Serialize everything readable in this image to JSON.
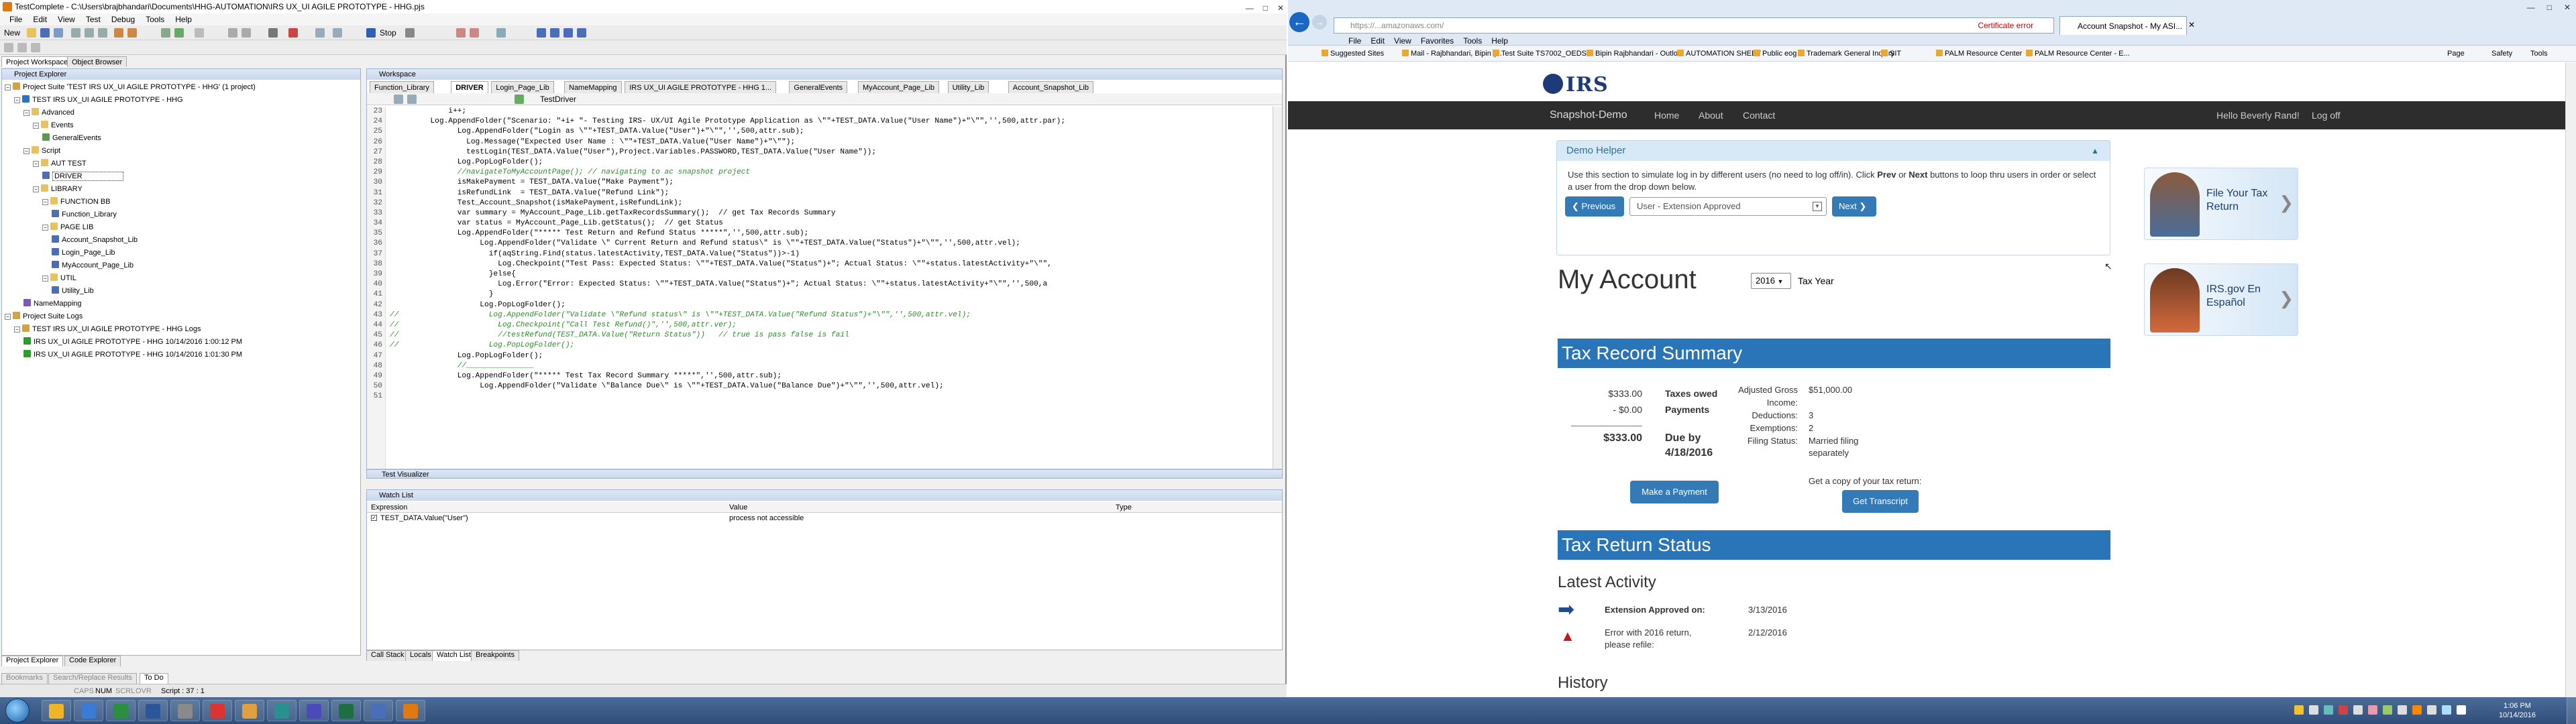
{
  "ide": {
    "title": "TestComplete - C:\\Users\\brajbhandari\\Documents\\HHG-AUTOMATION\\IRS UX_UI AGILE PROTOTYPE - HHG.pjs",
    "menu": [
      "File",
      "Edit",
      "View",
      "Test",
      "Debug",
      "Tools",
      "Help"
    ],
    "new_label": "New",
    "stop_label": "Stop",
    "panel_tabs": [
      "Project Workspace",
      "Object Browser"
    ],
    "project_explorer": {
      "title": "Project Explorer",
      "tree": [
        {
          "level": 0,
          "label": "Project Suite 'TEST IRS UX_UI AGILE PROTOTYPE - HHG' (1 project)",
          "color": "#d6a23a",
          "expand": "−"
        },
        {
          "level": 1,
          "label": "TEST IRS UX_UI AGILE PROTOTYPE - HHG",
          "color": "#2f72c4",
          "expand": "−"
        },
        {
          "level": 2,
          "label": "Advanced",
          "color": "#e8c25a",
          "expand": "−"
        },
        {
          "level": 3,
          "label": "Events",
          "color": "#e8c25a",
          "expand": "−"
        },
        {
          "level": 4,
          "label": "GeneralEvents",
          "color": "#5a9b4c",
          "expand": ""
        },
        {
          "level": 2,
          "label": "Script",
          "color": "#e8c25a",
          "expand": "−"
        },
        {
          "level": 3,
          "label": "AUT TEST",
          "color": "#e8c25a",
          "expand": "−"
        },
        {
          "level": 4,
          "label": "DRIVER",
          "color": "#4a6fb8",
          "expand": "",
          "selected": true
        },
        {
          "level": 3,
          "label": "LIBRARY",
          "color": "#e8c25a",
          "expand": "−"
        },
        {
          "level": 4,
          "label": "FUNCTION BB",
          "color": "#e8c25a",
          "expand": "−"
        },
        {
          "level": 5,
          "label": "Function_Library",
          "color": "#4a6fb8",
          "expand": ""
        },
        {
          "level": 4,
          "label": "PAGE LIB",
          "color": "#e8c25a",
          "expand": "−"
        },
        {
          "level": 5,
          "label": "Account_Snapshot_Lib",
          "color": "#4a6fb8",
          "expand": ""
        },
        {
          "level": 5,
          "label": "Login_Page_Lib",
          "color": "#4a6fb8",
          "expand": ""
        },
        {
          "level": 5,
          "label": "MyAccount_Page_Lib",
          "color": "#4a6fb8",
          "expand": ""
        },
        {
          "level": 4,
          "label": "UTIL",
          "color": "#e8c25a",
          "expand": "−"
        },
        {
          "level": 5,
          "label": "Utility_Lib",
          "color": "#4a6fb8",
          "expand": ""
        },
        {
          "level": 2,
          "label": "NameMapping",
          "color": "#7a5ab8",
          "expand": ""
        },
        {
          "level": 0,
          "label": "Project Suite Logs",
          "color": "#d6a23a",
          "expand": "−"
        },
        {
          "level": 1,
          "label": "TEST IRS UX_UI AGILE PROTOTYPE - HHG Logs",
          "color": "#d6a23a",
          "expand": "−"
        },
        {
          "level": 2,
          "label": "IRS UX_UI AGILE PROTOTYPE - HHG 10/14/2016 1:00:12 PM",
          "color": "#2aa02a",
          "expand": ""
        },
        {
          "level": 2,
          "label": "IRS UX_UI AGILE PROTOTYPE - HHG 10/14/2016 1:01:30 PM",
          "color": "#2aa02a",
          "expand": ""
        }
      ],
      "bottom_tabs": [
        "Project Explorer",
        "Code Explorer"
      ],
      "bottom_tabs2": [
        "Bookmarks",
        "Search/Replace Results",
        "To Do"
      ]
    },
    "workspace": {
      "title": "Workspace",
      "tabs": [
        "Function_Library",
        "DRIVER",
        "Login_Page_Lib",
        "NameMapping",
        "IRS UX_UI AGILE PROTOTYPE - HHG 1...",
        "GeneralEvents",
        "MyAccount_Page_Lib",
        "Utility_Lib",
        "Account_Snapshot_Lib"
      ],
      "active_tab": "DRIVER",
      "toolbar_label": "TestDriver",
      "line_numbers": [
        "23",
        "24",
        "25",
        "26",
        "27",
        "28",
        "29",
        "30",
        "31",
        "32",
        "33",
        "34",
        "35",
        "36",
        "37",
        "38",
        "39",
        "40",
        "41",
        "42",
        "43",
        "44",
        "45",
        "46",
        "47",
        "48",
        "49",
        "50",
        "51"
      ],
      "code": [
        {
          "t": "             i++;",
          "c": ""
        },
        {
          "t": "         Log.AppendFolder(\"Scenario: \"+i+ \"- Testing IRS- UX/UI Agile Prototype Application as \\\"\"+TEST_DATA.Value(\"User Name\")+\"\\\"\",'',500,attr.par);",
          "c": ""
        },
        {
          "t": "               Log.AppendFolder(\"Login as \\\"\"+TEST_DATA.Value(\"User\")+\"\\\"\",'',500,attr.sub);",
          "c": ""
        },
        {
          "t": "                 Log.Message(\"Expected User Name : \\\"\"+TEST_DATA.Value(\"User Name\")+\"\\\"\");",
          "c": ""
        },
        {
          "t": "                 testLogin(TEST_DATA.Value(\"User\"),Project.Variables.PASSWORD,TEST_DATA.Value(\"User Name\"));",
          "c": ""
        },
        {
          "t": "               Log.PopLogFolder();",
          "c": ""
        },
        {
          "t": "               //navigateToMyAccountPage(); // navigating to ac snapshot project",
          "c": "cmt"
        },
        {
          "t": "               isMakePayment = TEST_DATA.Value(\"Make Payment\");",
          "c": ""
        },
        {
          "t": "               isRefundLink  = TEST_DATA.Value(\"Refund Link\");",
          "c": ""
        },
        {
          "t": "               Test_Account_Snapshot(isMakePayment,isRefundLink);",
          "c": ""
        },
        {
          "t": "               var summary = MyAccount_Page_Lib.getTaxRecordsSummary();  // get Tax Records Summary",
          "c": ""
        },
        {
          "t": "               var status = MyAccount_Page_Lib.getStatus();  // get Status",
          "c": ""
        },
        {
          "t": "               Log.AppendFolder(\"***** Test Return and Refund Status *****\",'',500,attr.sub);",
          "c": ""
        },
        {
          "t": "                    Log.AppendFolder(\"Validate \\\" Current Return and Refund status\\\" is \\\"\"+TEST_DATA.Value(\"Status\")+\"\\\"\",'',500,attr.vel);",
          "c": ""
        },
        {
          "t": "                      if(aqString.Find(status.latestActivity,TEST_DATA.Value(\"Status\"))>-1)",
          "c": ""
        },
        {
          "t": "                        Log.Checkpoint(\"Test Pass: Expected Status: \\\"\"+TEST_DATA.Value(\"Status\")+\"; Actual Status: \\\"\"+status.latestActivity+\"\\\"\",",
          "c": ""
        },
        {
          "t": "                      }else{",
          "c": ""
        },
        {
          "t": "                        Log.Error(\"Error: Expected Status: \\\"\"+TEST_DATA.Value(\"Status\")+\"; Actual Status: \\\"\"+status.latestActivity+\"\\\"\",'',500,a",
          "c": ""
        },
        {
          "t": "                      }",
          "c": ""
        },
        {
          "t": "                    Log.PopLogFolder();",
          "c": ""
        },
        {
          "t": "//                    Log.AppendFolder(\"Validate \\\"Refund status\\\" is \\\"\"+TEST_DATA.Value(\"Refund Status\")+\"\\\"\",'',500,attr.vel);",
          "c": "cmt"
        },
        {
          "t": "//                      Log.Checkpoint(\"Call Test Refund()\",'',500,attr.ver);",
          "c": "cmt"
        },
        {
          "t": "//                      //testRefund(TEST_DATA.Value(\"Return Status\"))   // true is pass false is fail",
          "c": "cmt"
        },
        {
          "t": "//                    Log.PopLogFolder();",
          "c": "cmt"
        },
        {
          "t": "               Log.PopLogFolder();",
          "c": ""
        },
        {
          "t": "               //_______________",
          "c": "cmt"
        },
        {
          "t": "               Log.AppendFolder(\"***** Test Tax Record Summary *****\",'',500,attr.sub);",
          "c": ""
        },
        {
          "t": "                    Log.AppendFolder(\"Validate \\\"Balance Due\\\" is \\\"\"+TEST_DATA.Value(\"Balance Due\")+\"\\\"\",'',500,attr.vel);",
          "c": ""
        },
        {
          "t": "",
          "c": ""
        }
      ]
    },
    "test_visualizer": "Test Visualizer",
    "watch_list": {
      "title": "Watch List",
      "columns": [
        "Expression",
        "Value",
        "Type"
      ],
      "rows": [
        {
          "expr": "TEST_DATA.Value(\"User\")",
          "value": "process not accessible",
          "type": ""
        }
      ],
      "bottom_tabs": [
        "Call Stack",
        "Locals",
        "Watch List",
        "Breakpoints"
      ]
    },
    "status": {
      "caps": "CAPS",
      "num": "NUM",
      "scrl": "SCRL",
      "ovr": "OVR",
      "pos": "Script : 37 : 1"
    }
  },
  "browser": {
    "url": "https://...amazonaws.com/",
    "cert_error": "Certificate error",
    "tab_title": "Account Snapshot - My ASI...",
    "menu": [
      "File",
      "Edit",
      "View",
      "Favorites",
      "Tools",
      "Help"
    ],
    "favorites": [
      "Suggested Sites",
      "Mail - Rajbhandari, Bipin (...",
      "Test Suite TS7002_OEDS...",
      "Bipin Rajbhandari - Outlo...",
      "AUTOMATION SHEET",
      "Public eog",
      "Trademark General Inquiry",
      "SIT",
      "PALM Resource Center",
      "PALM Resource Center - E..."
    ],
    "toolbar_right": [
      "Page",
      "Safety",
      "Tools"
    ]
  },
  "irs": {
    "logo": "IRS",
    "nav": {
      "brand": "Snapshot-Demo",
      "links": [
        "Home",
        "About",
        "Contact"
      ],
      "hello": "Hello Beverly Rand!",
      "logoff": "Log off"
    },
    "demo_helper": {
      "title": "Demo Helper",
      "text_1": "Use this section to simulate log in by different users (no need to log off/in). Click ",
      "prev_word": "Prev",
      "text_2": " or ",
      "next_word": "Next",
      "text_3": " buttons to loop thru users in order or select a user from the drop down below.",
      "prev_label": "Previous",
      "next_label": "Next",
      "user_selected": "User - Extension Approved"
    },
    "my_account": "My Account",
    "year": "2016",
    "year_label": "Tax Year",
    "tax_record_summary": {
      "title": "Tax Record Summary",
      "owed_amount": "$333.00",
      "owed_label": "Taxes owed",
      "payments_amount": "- $0.00",
      "payments_label": "Payments",
      "total": "$333.00",
      "due_label": "Due by",
      "due_date": "4/18/2016",
      "make_payment": "Make a Payment",
      "details": [
        {
          "k": "Adjusted Gross",
          "v": "$51,000.00"
        },
        {
          "k": "Income:",
          "v": ""
        },
        {
          "k": "Deductions:",
          "v": "3"
        },
        {
          "k": "Exemptions:",
          "v": "2"
        },
        {
          "k": "Filing Status:",
          "v": "Married filing separately"
        }
      ],
      "copy_text": "Get a copy of your tax return:",
      "transcript": "Get Transcript"
    },
    "tax_return_status": {
      "title": "Tax Return Status",
      "latest": "Latest Activity",
      "activities": [
        {
          "icon": "arrow-right-icon",
          "text": "Extension Approved on:",
          "date": "3/13/2016",
          "bold": true
        },
        {
          "icon": "warning-icon",
          "text": "Error with 2016 return, please refile:",
          "date": "2/12/2016",
          "bold": false
        }
      ],
      "history": "History"
    },
    "promos": [
      {
        "title": "File Your Tax Return"
      },
      {
        "title": "IRS.gov En Español"
      }
    ]
  },
  "taskbar": {
    "clock_time": "1:06 PM",
    "clock_date": "10/14/2016"
  }
}
